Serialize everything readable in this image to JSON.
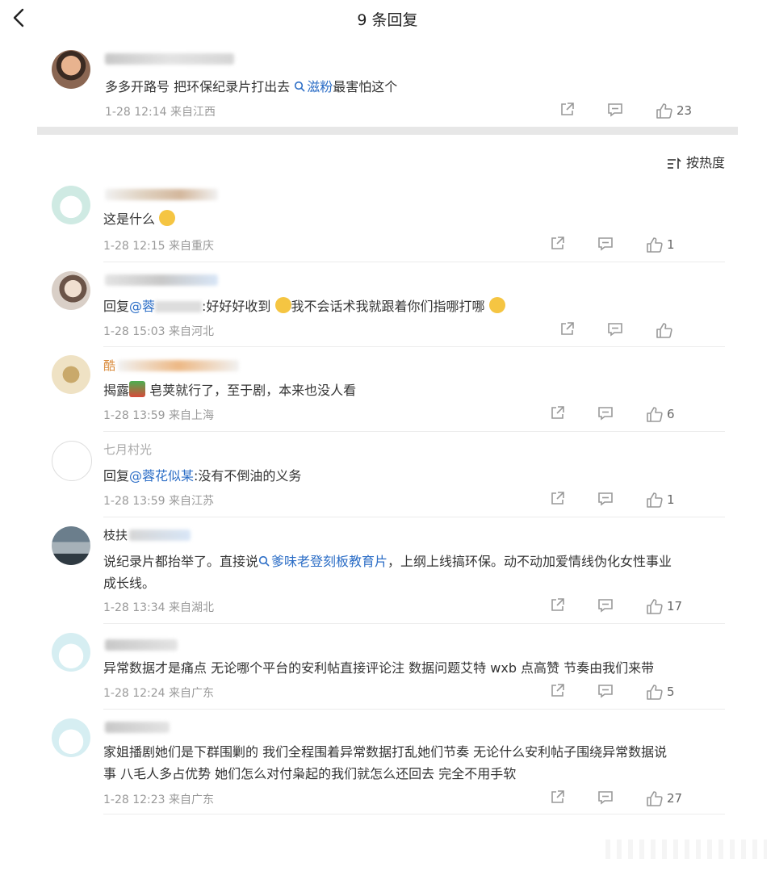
{
  "header": {
    "title": "9 条回复"
  },
  "root_comment": {
    "text_before": "多多开路号 把环保纪录片打出去 ",
    "link_text": "滋粉",
    "text_after": "最害怕这个",
    "time": "1-28 12:14",
    "location": "来自江西",
    "likes": "23"
  },
  "sort": {
    "label": "按热度"
  },
  "replies": [
    {
      "text": "这是什么",
      "time": "1-28 12:15",
      "location": "来自重庆",
      "likes": "1"
    },
    {
      "prefix": "回复",
      "mention": "@蓉",
      "text": ":好好好收到",
      "text2": "我不会话术我就跟着你们指哪打哪",
      "time": "1-28 15:03",
      "location": "来自河北",
      "likes": ""
    },
    {
      "name_fragment": "酷",
      "text": "揭露",
      "text2": " 皂荚就行了，至于剧，本来也没人看",
      "time": "1-28 13:59",
      "location": "来自上海",
      "likes": "6"
    },
    {
      "name_fragment": "七月村光",
      "prefix": "回复",
      "mention": "@蓉花似某",
      "text": ":没有不倒油的义务",
      "time": "1-28 13:59",
      "location": "来自江苏",
      "likes": "1"
    },
    {
      "name_fragment": "枝扶",
      "text_before": "说纪录片都抬举了。直接说",
      "link_text": "爹味老登刻板教育片",
      "text_after": "，上纲上线搞环保。动不动加爱情线伪化女性事业",
      "text_line2": "成长线。",
      "time": "1-28 13:34",
      "location": "来自湖北",
      "likes": "17"
    },
    {
      "text": "异常数据才是痛点 无论哪个平台的安利帖直接评论注 数据问题艾特 wxb 点高赞 节奏由我们来带",
      "time": "1-28 12:24",
      "location": "来自广东",
      "likes": "5"
    },
    {
      "text_line1": "家姐播剧她们是下群围剿的 我们全程围着异常数据打乱她们节奏 无论什么安利帖子围绕异常数据说",
      "text_line2": "事 八毛人多占优势 她们怎么对付枭起的我们就怎么还回去 完全不用手软",
      "time": "1-28 12:23",
      "location": "来自广东",
      "likes": "27"
    }
  ],
  "icons": {
    "back": "chevron-left-icon",
    "share": "share-icon",
    "comment": "comment-icon",
    "like": "thumbs-up-icon",
    "sort": "sort-icon",
    "search": "search-icon"
  },
  "colors": {
    "link": "#2b6dc6",
    "meta": "#999999",
    "divider": "#e7e7e7"
  }
}
